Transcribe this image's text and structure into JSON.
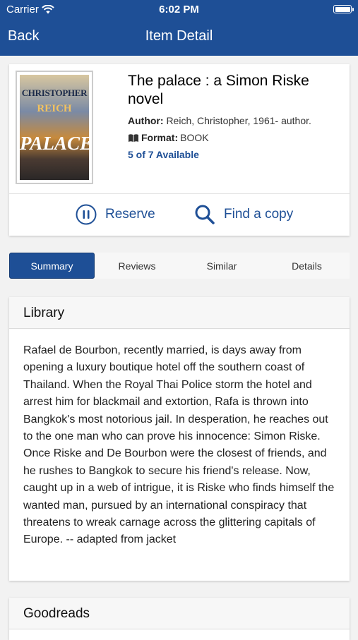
{
  "status": {
    "carrier": "Carrier",
    "time": "6:02 PM"
  },
  "nav": {
    "back": "Back",
    "title": "Item Detail"
  },
  "item": {
    "title": "The palace : a Simon Riske novel",
    "author_label": "Author:",
    "author_value": "Reich, Christopher, 1961- author.",
    "format_label": "Format:",
    "format_value": "BOOK",
    "availability": "5 of 7 Available",
    "cover": {
      "author": "CHRISTOPHER",
      "author2": "REICH",
      "title": "PALACE"
    }
  },
  "actions": {
    "reserve": "Reserve",
    "find_copy": "Find a copy"
  },
  "tabs": [
    "Summary",
    "Reviews",
    "Similar",
    "Details"
  ],
  "active_tab": "Summary",
  "library": {
    "heading": "Library",
    "summary": "Rafael de Bourbon, recently married, is days away from opening a luxury boutique hotel off the southern coast of Thailand. When the Royal Thai Police storm the hotel and arrest him for blackmail and extortion, Rafa is thrown into Bangkok's most notorious jail. In desperation, he reaches out to the one man who can prove his innocence: Simon Riske. Once Riske and De Bourbon were the closest of friends, and he rushes to Bangkok to secure his friend's release. Now, caught up in a web of intrigue, it is Riske who finds himself the wanted man, pursued by an international conspiracy that threatens to wreak carnage across the glittering capitals of Europe. -- adapted from jacket"
  },
  "goodreads": {
    "heading": "Goodreads"
  },
  "colors": {
    "primary": "#1e4f96"
  },
  "icons": {
    "wifi": "wifi-icon",
    "battery": "battery-icon",
    "reserve": "pause-circle-icon",
    "find": "search-icon",
    "format": "book-icon"
  }
}
